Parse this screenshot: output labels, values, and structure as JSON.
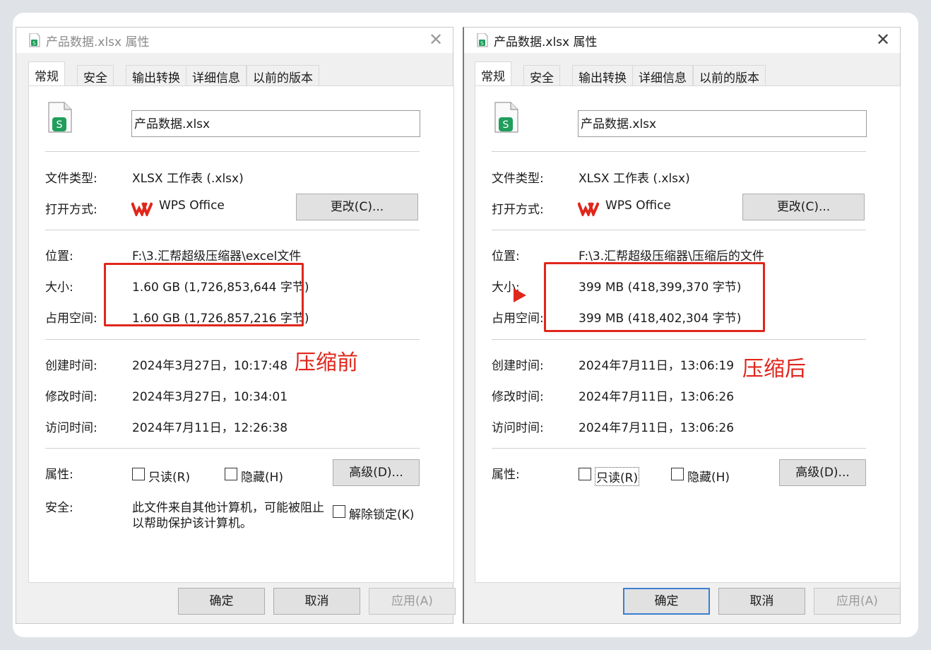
{
  "left": {
    "title": "产品数据.xlsx 属性",
    "close": "✕",
    "tabs": [
      "常规",
      "安全",
      "输出转换",
      "详细信息",
      "以前的版本"
    ],
    "filename": "产品数据.xlsx",
    "file_type_label": "文件类型:",
    "file_type_value": "XLSX 工作表 (.xlsx)",
    "open_with_label": "打开方式:",
    "open_with_value": "WPS Office",
    "change_button": "更改(C)...",
    "location_label": "位置:",
    "location_value": "F:\\3.汇帮超级压缩器\\excel文件",
    "size_label": "大小:",
    "size_value": "1.60 GB (1,726,853,644 字节)",
    "disk_label": "占用空间:",
    "disk_value": "1.60 GB (1,726,857,216 字节)",
    "created_label": "创建时间:",
    "created_value": "2024年3月27日，10:17:48",
    "modified_label": "修改时间:",
    "modified_value": "2024年3月27日，10:34:01",
    "accessed_label": "访问时间:",
    "accessed_value": "2024年7月11日，12:26:38",
    "attributes_label": "属性:",
    "readonly_label": "只读(R)",
    "hidden_label": "隐藏(H)",
    "advanced_button": "高级(D)...",
    "security_label": "安全:",
    "security_text_1": "此文件来自其他计算机，可能被阻止",
    "security_text_2": "以帮助保护该计算机。",
    "unblock_label": "解除锁定(K)",
    "ok_button": "确定",
    "cancel_button": "取消",
    "apply_button": "应用(A)"
  },
  "right": {
    "title": "产品数据.xlsx 属性",
    "close": "✕",
    "tabs": [
      "常规",
      "安全",
      "输出转换",
      "详细信息",
      "以前的版本"
    ],
    "filename": "产品数据.xlsx",
    "file_type_label": "文件类型:",
    "file_type_value": "XLSX 工作表 (.xlsx)",
    "open_with_label": "打开方式:",
    "open_with_value": "WPS Office",
    "change_button": "更改(C)...",
    "location_label": "位置:",
    "location_value": "F:\\3.汇帮超级压缩器\\压缩后的文件",
    "size_label": "大小:",
    "size_value": "399 MB (418,399,370 字节)",
    "disk_label": "占用空间:",
    "disk_value": "399 MB (418,402,304 字节)",
    "created_label": "创建时间:",
    "created_value": "2024年7月11日，13:06:19",
    "modified_label": "修改时间:",
    "modified_value": "2024年7月11日，13:06:26",
    "accessed_label": "访问时间:",
    "accessed_value": "2024年7月11日，13:06:26",
    "attributes_label": "属性:",
    "readonly_label": "只读(R)",
    "hidden_label": "隐藏(H)",
    "advanced_button": "高级(D)...",
    "ok_button": "确定",
    "cancel_button": "取消",
    "apply_button": "应用(A)"
  },
  "annotations": {
    "before_label": "压缩前",
    "after_label": "压缩后",
    "color": "#e0261c"
  },
  "colors": {
    "wps_red": "#e0261c",
    "sheet_green": "#1f9e5c",
    "default_button_border": "#3b7fd1"
  },
  "icons": {
    "file_icon": "wps-spreadsheet-icon",
    "open_with_icon": "wps-logo-icon",
    "close_icon": "close-icon"
  }
}
